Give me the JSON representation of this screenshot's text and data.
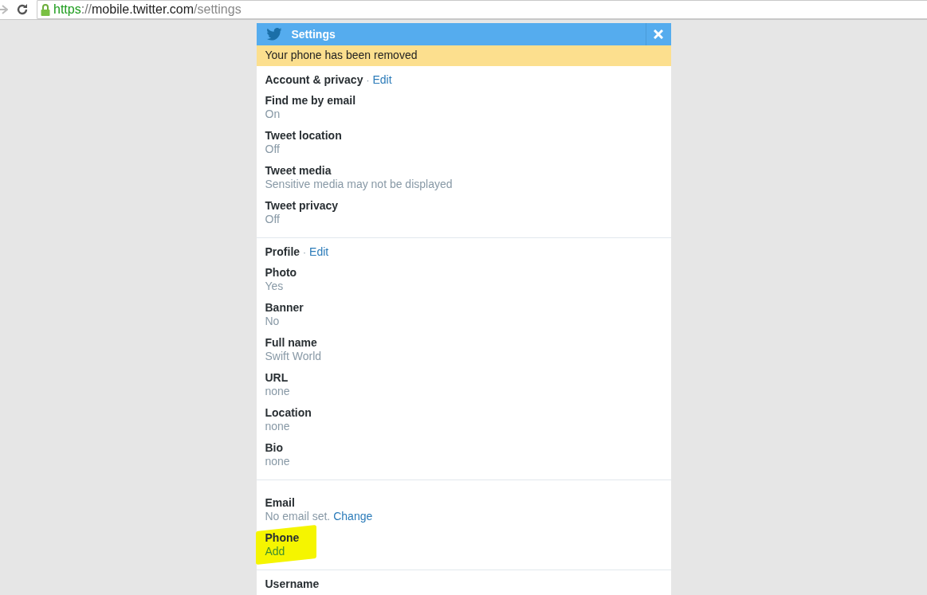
{
  "browser": {
    "url": {
      "scheme": "https",
      "separator": "://",
      "host": "mobile.twitter.com",
      "path": "/settings"
    }
  },
  "header": {
    "title": "Settings"
  },
  "notice": "Your phone has been removed",
  "sections": [
    {
      "title": "Account & privacy",
      "separator": "·",
      "action": "Edit",
      "items": [
        {
          "label": "Find me by email",
          "value": "On",
          "highlighted": false
        },
        {
          "label": "Tweet location",
          "value": "Off",
          "highlighted": false
        },
        {
          "label": "Tweet media",
          "value": "Sensitive media may not be displayed",
          "highlighted": false
        },
        {
          "label": "Tweet privacy",
          "value": "Off",
          "highlighted": false
        }
      ]
    },
    {
      "title": "Profile",
      "separator": "·",
      "action": "Edit",
      "items": [
        {
          "label": "Photo",
          "value": "Yes",
          "highlighted": false
        },
        {
          "label": "Banner",
          "value": "No",
          "highlighted": false
        },
        {
          "label": "Full name",
          "value": "Swift World",
          "highlighted": false
        },
        {
          "label": "URL",
          "value": "none",
          "highlighted": false
        },
        {
          "label": "Location",
          "value": "none",
          "highlighted": false
        },
        {
          "label": "Bio",
          "value": "none",
          "highlighted": false
        }
      ]
    },
    {
      "items": [
        {
          "label": "Email",
          "value": "No email set.",
          "link": "Change",
          "highlighted": false
        },
        {
          "label": "Phone",
          "link": "Add",
          "highlighted": true
        }
      ]
    },
    {
      "items": [
        {
          "label": "Username",
          "highlighted": false
        }
      ]
    }
  ]
}
